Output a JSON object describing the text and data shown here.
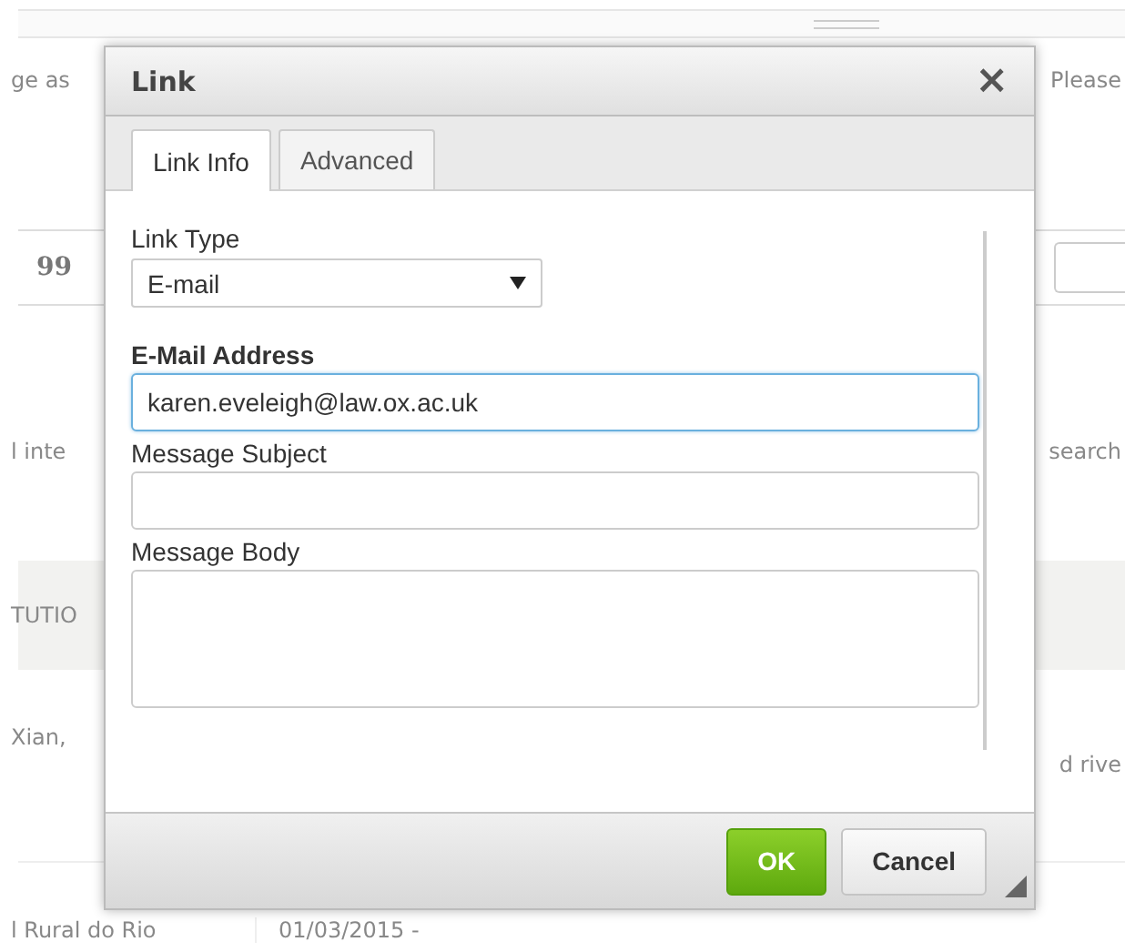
{
  "background": {
    "rows": [
      {
        "left": "ge as",
        "right": "Please"
      },
      {
        "left": "l inte",
        "right": "search"
      },
      {
        "left": "TUTIO"
      },
      {
        "left": "Xian,",
        "right": "d rive"
      },
      {
        "left": "l Rural do Rio",
        "right": "01/03/2015 -"
      }
    ],
    "quote_glyph": "99"
  },
  "dialog": {
    "title": "Link",
    "close": "×",
    "tabs": [
      {
        "label": "Link Info",
        "selected": true
      },
      {
        "label": "Advanced",
        "selected": false
      }
    ],
    "link_type": {
      "label": "Link Type",
      "value": "E-mail"
    },
    "fields": [
      {
        "label": "E-Mail Address",
        "value": "karen.eveleigh@law.ox.ac.uk",
        "focused": true,
        "kind": "input"
      },
      {
        "label": "Message Subject",
        "focused": false,
        "kind": "input"
      },
      {
        "label": "Message Body",
        "focused": false,
        "kind": "textarea"
      }
    ],
    "buttons": [
      {
        "label": "OK",
        "kind": "primary"
      },
      {
        "label": "Cancel",
        "kind": "secondary"
      }
    ]
  }
}
